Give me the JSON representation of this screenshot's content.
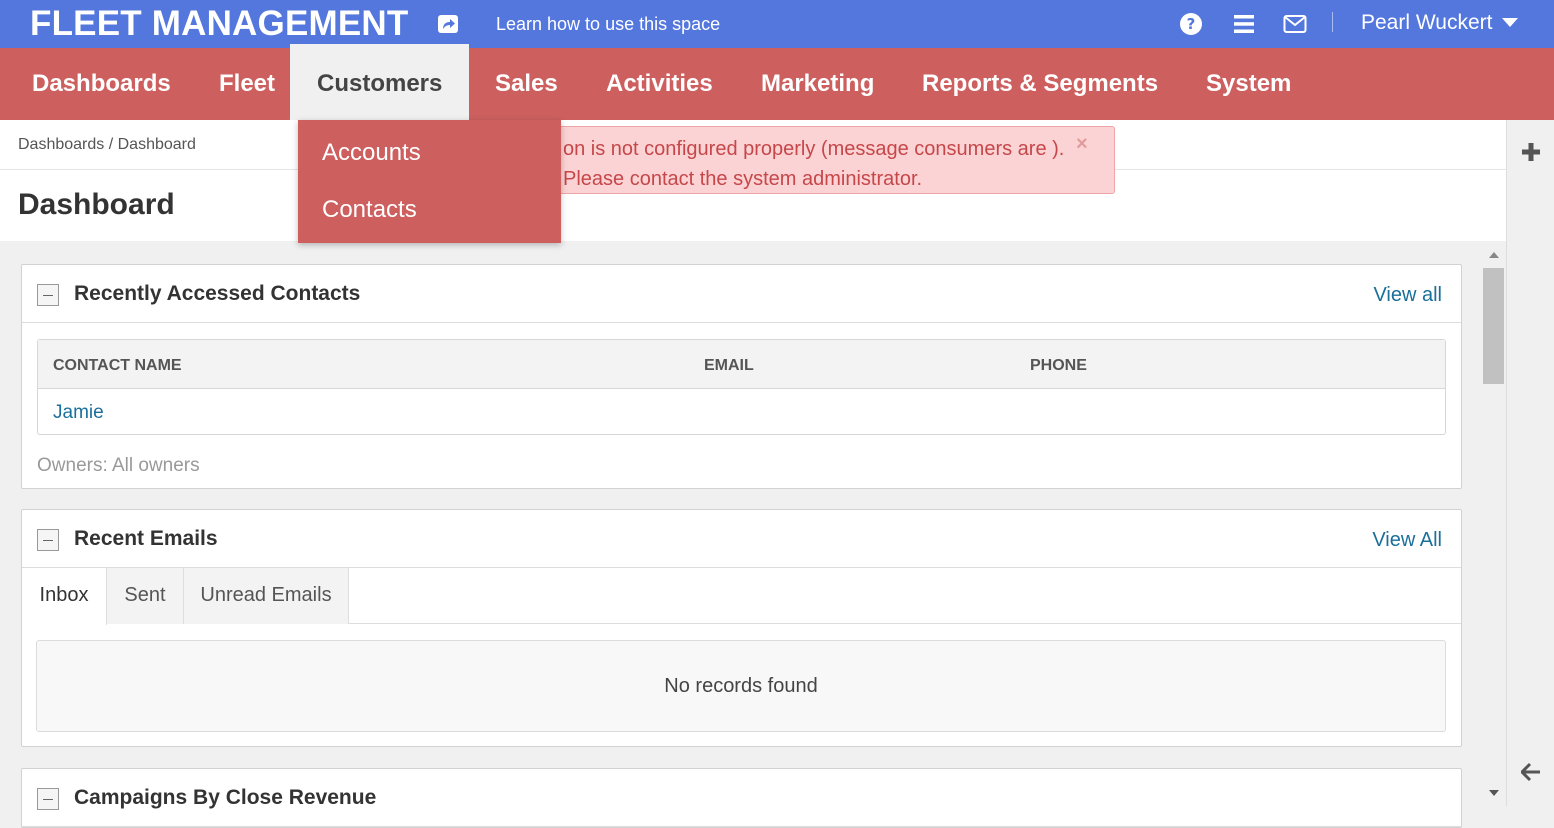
{
  "topbar": {
    "logo": "FLEET MANAGEMENT",
    "learn_link": "Learn how to use this space",
    "user_name": "Pearl Wuckert",
    "color": "#5477de"
  },
  "mainnav": {
    "color": "#cd5f5f",
    "items": [
      {
        "label": "Dashboards"
      },
      {
        "label": "Fleet"
      },
      {
        "label": "Customers",
        "active": true
      },
      {
        "label": "Sales"
      },
      {
        "label": "Activities"
      },
      {
        "label": "Marketing"
      },
      {
        "label": "Reports & Segments"
      },
      {
        "label": "System"
      }
    ],
    "dropdown": [
      "Accounts",
      "Contacts"
    ]
  },
  "breadcrumb": "Dashboards / Dashboard",
  "page_title": "Dashboard",
  "alert": {
    "visible_text": "on is not configured properly (message consumers are ). Please contact the system administrator.",
    "close": "×"
  },
  "contacts_widget": {
    "title": "Recently Accessed Contacts",
    "view_all": "View all",
    "columns": [
      "CONTACT NAME",
      "EMAIL",
      "PHONE"
    ],
    "rows": [
      {
        "name": "Jamie",
        "email": "",
        "phone": ""
      }
    ],
    "owners": "Owners: All owners"
  },
  "emails_widget": {
    "title": "Recent Emails",
    "view_all": "View All",
    "tabs": [
      "Inbox",
      "Sent",
      "Unread Emails"
    ],
    "active_tab": "Inbox",
    "empty": "No records found"
  },
  "campaigns_widget": {
    "title": "Campaigns By Close Revenue"
  },
  "icons": [
    "share-icon",
    "help-icon",
    "menu-icon",
    "mail-icon",
    "caret-down-icon",
    "plus-icon",
    "arrow-left-icon"
  ]
}
